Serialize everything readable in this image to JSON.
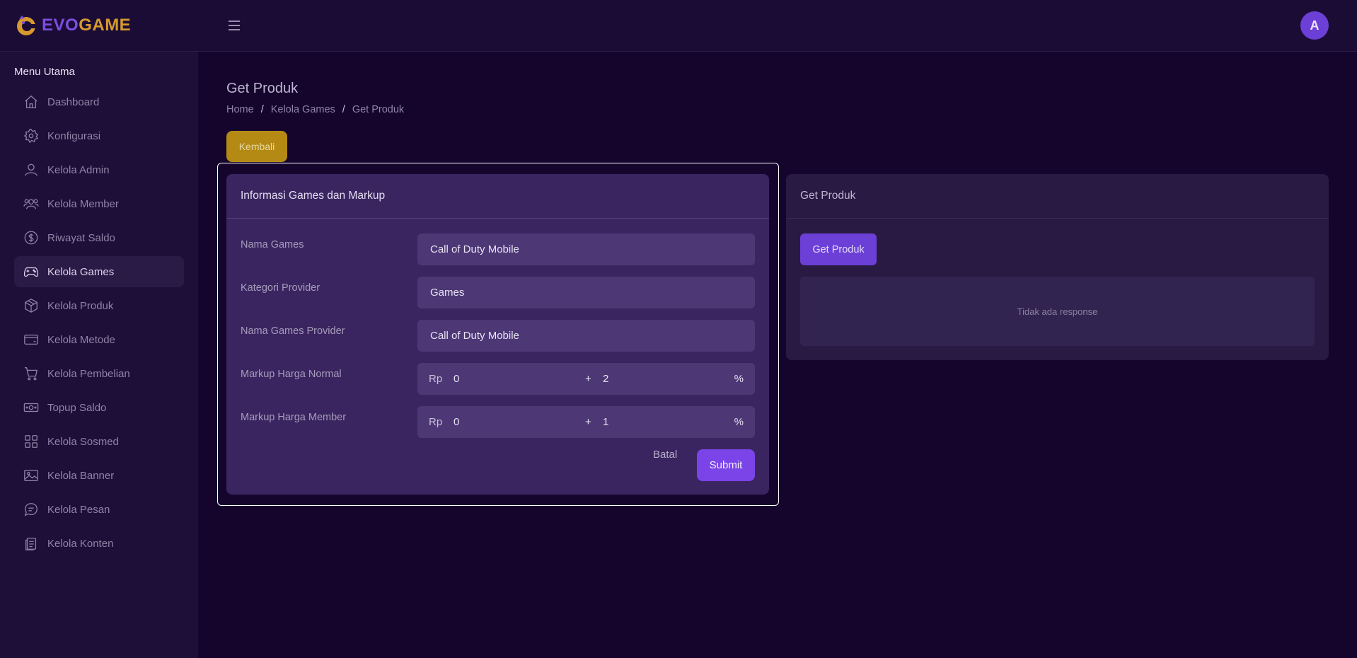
{
  "header": {
    "logo_part1": "EVO",
    "logo_part2": "GAME",
    "avatar_initial": "A"
  },
  "sidebar": {
    "title": "Menu Utama",
    "items": [
      {
        "label": "Dashboard",
        "icon": "home-icon"
      },
      {
        "label": "Konfigurasi",
        "icon": "gear-icon"
      },
      {
        "label": "Kelola Admin",
        "icon": "user-icon"
      },
      {
        "label": "Kelola Member",
        "icon": "users-icon"
      },
      {
        "label": "Riwayat Saldo",
        "icon": "dollar-circle-icon"
      },
      {
        "label": "Kelola Games",
        "icon": "gamepad-icon",
        "active": true
      },
      {
        "label": "Kelola Produk",
        "icon": "box-icon"
      },
      {
        "label": "Kelola Metode",
        "icon": "credit-card-icon"
      },
      {
        "label": "Kelola Pembelian",
        "icon": "cart-icon"
      },
      {
        "label": "Topup Saldo",
        "icon": "money-icon"
      },
      {
        "label": "Kelola Sosmed",
        "icon": "grid-icon"
      },
      {
        "label": "Kelola Banner",
        "icon": "image-icon"
      },
      {
        "label": "Kelola Pesan",
        "icon": "chat-icon"
      },
      {
        "label": "Kelola Konten",
        "icon": "document-icon"
      }
    ]
  },
  "page": {
    "title": "Get Produk",
    "breadcrumb": [
      "Home",
      "Kelola Games",
      "Get Produk"
    ],
    "back_label": "Kembali"
  },
  "form_card": {
    "title": "Informasi Games dan Markup",
    "fields": [
      {
        "label": "Nama Games",
        "value": "Call of Duty Mobile"
      },
      {
        "label": "Kategori Provider",
        "value": "Games"
      },
      {
        "label": "Nama Games Provider",
        "value": "Call of Duty Mobile"
      }
    ],
    "markups": [
      {
        "label": "Markup Harga Normal",
        "prefix": "Rp",
        "amount": "0",
        "plus": "+",
        "percent": "2",
        "suffix": "%"
      },
      {
        "label": "Markup Harga Member",
        "prefix": "Rp",
        "amount": "0",
        "plus": "+",
        "percent": "1",
        "suffix": "%"
      }
    ],
    "cancel_label": "Batal",
    "submit_label": "Submit"
  },
  "product_card": {
    "title": "Get Produk",
    "button_label": "Get Produk",
    "response_text": "Tidak ada response"
  },
  "colors": {
    "background": "#15052d",
    "sidebar": "#1e0f38",
    "accent": "#7b44e8",
    "back_button": "#b48a14",
    "logo_evo": "#7b4fe0",
    "logo_game": "#d69a2d"
  }
}
